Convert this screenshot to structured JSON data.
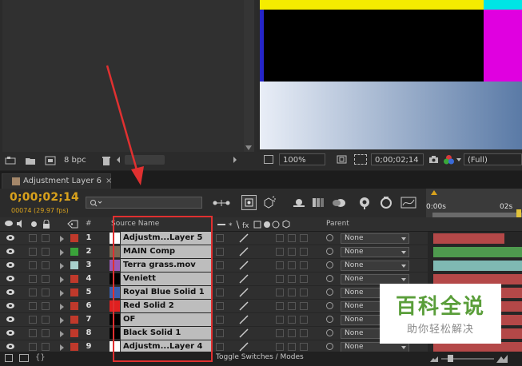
{
  "colors": {
    "timecode": "#d9a21c",
    "annotation": "#e03030",
    "name_cell_bg": "#bdbdbd",
    "watermark_text": "#5a9e3a"
  },
  "project_panel": {
    "bpc_label": "8 bpc"
  },
  "viewer": {
    "zoom": "100%",
    "timecode": "0;00;02;14",
    "resolution": "(Full)"
  },
  "timeline": {
    "tab_label": "Adjustment Layer 6",
    "tab_close": "×",
    "timecode": "0;00;02;14",
    "frame_info": "00074 (29.97 fps)",
    "ruler_labels": [
      "0:00s",
      "02s"
    ],
    "columns": {
      "number": "#",
      "source_name": "Source Name",
      "parent": "Parent"
    },
    "layers": [
      {
        "num": "1",
        "name": "Adjustm...Layer 5",
        "label_color": "#c0392b",
        "thumb": "#ffffff",
        "parent": "None",
        "bar_color": "#b44848"
      },
      {
        "num": "2",
        "name": "MAIN Comp",
        "label_color": "#3aa33a",
        "thumb": "#7a6a55",
        "parent": "None",
        "bar_color": "#4e9a4e"
      },
      {
        "num": "3",
        "name": "Terra grass.mov",
        "label_color": "#a8d0cc",
        "thumb": "#9b59b6",
        "parent": "None",
        "bar_color": "#7fb9b3"
      },
      {
        "num": "4",
        "name": "Veniett",
        "label_color": "#c0392b",
        "thumb": "#000000",
        "parent": "None",
        "bar_color": "#b44848"
      },
      {
        "num": "5",
        "name": "Royal Blue Solid 1",
        "label_color": "#c0392b",
        "thumb": "#3a5fb0",
        "parent": "None",
        "bar_color": "#b44848"
      },
      {
        "num": "6",
        "name": "Red Solid 2",
        "label_color": "#c0392b",
        "thumb": "#e02020",
        "parent": "None",
        "bar_color": "#b44848"
      },
      {
        "num": "7",
        "name": "OF",
        "label_color": "#c0392b",
        "thumb": "#000000",
        "parent": "None",
        "bar_color": "#b44848"
      },
      {
        "num": "8",
        "name": "Black Solid 1",
        "label_color": "#c0392b",
        "thumb": "#000000",
        "parent": "None",
        "bar_color": "#b44848"
      },
      {
        "num": "9",
        "name": "Adjustm...Layer 4",
        "label_color": "#c0392b",
        "thumb": "#ffffff",
        "parent": "None",
        "bar_color": "#b44848"
      }
    ],
    "footer_toggle": "Toggle Switches / Modes"
  },
  "watermark": {
    "title": "百科全说",
    "subtitle": "助你轻松解决"
  }
}
